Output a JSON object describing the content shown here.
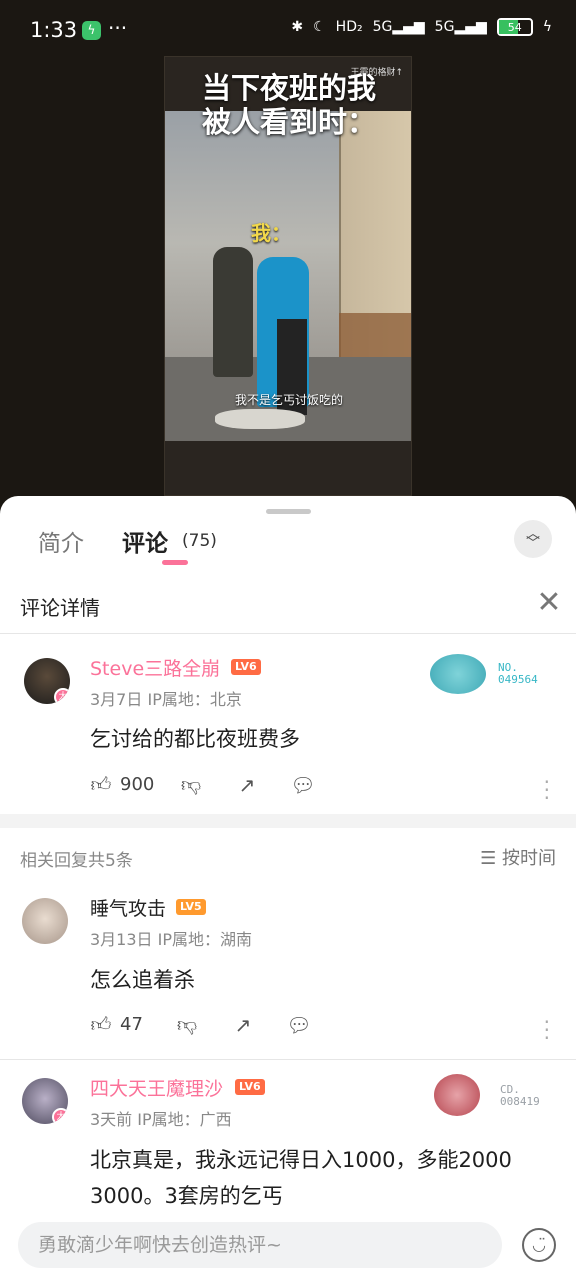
{
  "status_bar": {
    "time": "1:33",
    "battery": "54",
    "more": "···",
    "app_badge": "ϟ",
    "net1": "HD₂",
    "net2": "5G",
    "net3": "5G"
  },
  "video": {
    "title_line1": "当下夜班的我",
    "title_line2": "被人看到时：",
    "me_label": "我：",
    "subtitle": "我不是乞丐讨饭吃的",
    "watermark": "王霞的格财↑"
  },
  "tabs": {
    "intro": "简介",
    "comments": "评论",
    "comments_count": "(75)"
  },
  "detail": {
    "title": "评论详情"
  },
  "main_comment": {
    "username": "Steve三路全崩",
    "level": "LV6",
    "date": "3月7日",
    "ip": "IP属地：北京",
    "content": "乞讨给的都比夜班费多",
    "likes": "900",
    "fan_label": "NO.",
    "fan_number": "049564"
  },
  "replies_header": {
    "count_text": "相关回复共5条",
    "sort_label": "按时间"
  },
  "replies": [
    {
      "username": "睡气攻击",
      "level": "LV5",
      "date": "3月13日",
      "ip": "IP属地：湖南",
      "content": "怎么追着杀",
      "likes": "47"
    },
    {
      "username": "四大天王魔理沙",
      "level": "LV6",
      "date": "3天前",
      "ip": "IP属地：广西",
      "content_line1": "北京真是，我永远记得日入1000，多能2000",
      "content_line2": "3000。3套房的乞丐",
      "fan_label": "CD.",
      "fan_number": "008419"
    }
  ],
  "input": {
    "placeholder": "勇敢滴少年啊快去创造热评~"
  },
  "colors": {
    "accent": "#fb7299",
    "lv6": "#ff6b44",
    "lv5": "#ff9a2e"
  }
}
